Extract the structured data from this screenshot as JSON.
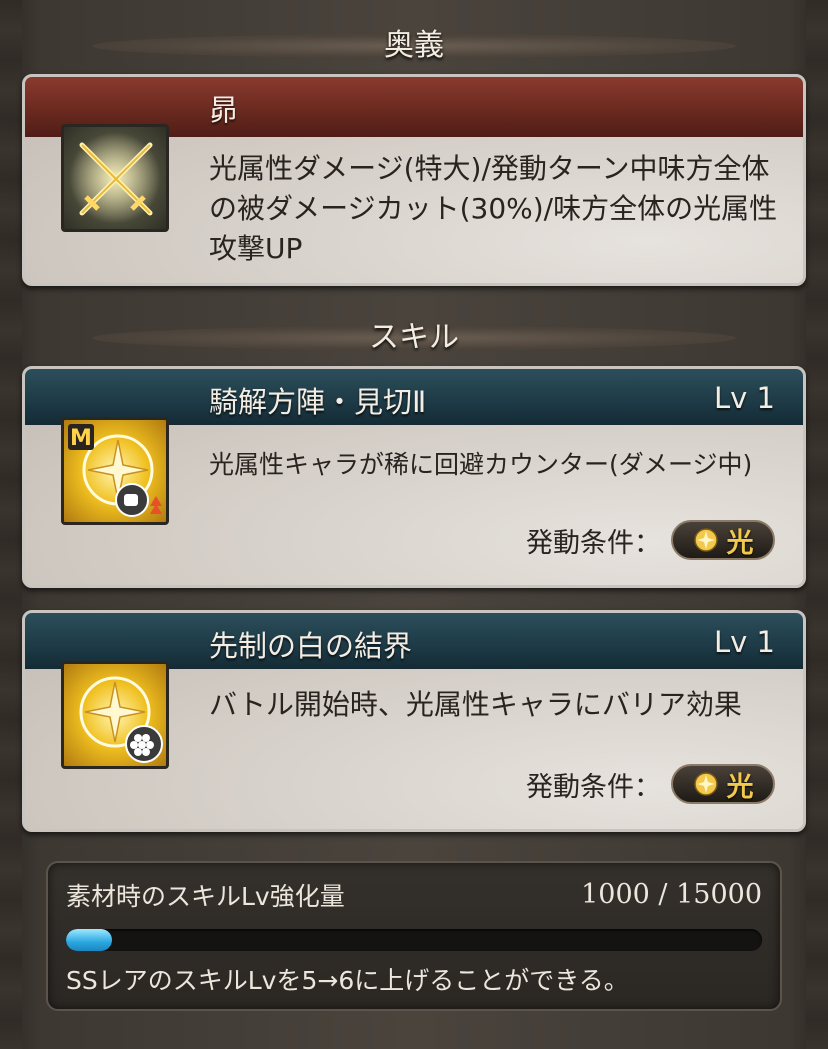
{
  "sections": {
    "ougi_header": "奥義",
    "skill_header": "スキル"
  },
  "ougi": {
    "name": "昴",
    "description": "光属性ダメージ(特大)/発動ターン中味方全体の被ダメージカット(30%)/味方全体の光属性攻撃UP",
    "icon": "crossed-swords-icon"
  },
  "skills": [
    {
      "name": "騎解方陣・見切Ⅱ",
      "level": "Lv 1",
      "description": "光属性キャラが稀に回避カウンター(ダメージ中)",
      "condition_label": "発動条件：",
      "condition_value": "光",
      "icon": "light-compass-counter-icon",
      "badge": "M"
    },
    {
      "name": "先制の白の結界",
      "level": "Lv 1",
      "description": "バトル開始時、光属性キャラにバリア効果",
      "condition_label": "発動条件：",
      "condition_value": "光",
      "icon": "light-compass-barrier-icon"
    }
  ],
  "material": {
    "label": "素材時のスキルLv強化量",
    "value": "1000 / 15000",
    "progress": 0.0667,
    "note": "SSレアのスキルLvを5→6に上げることができる。"
  },
  "colors": {
    "ougi_title_bg": "#6b2a20",
    "skill_title_bg": "#1d3a46",
    "light_element": "#f2c94c",
    "progress_fill": "#2aa7e0"
  }
}
